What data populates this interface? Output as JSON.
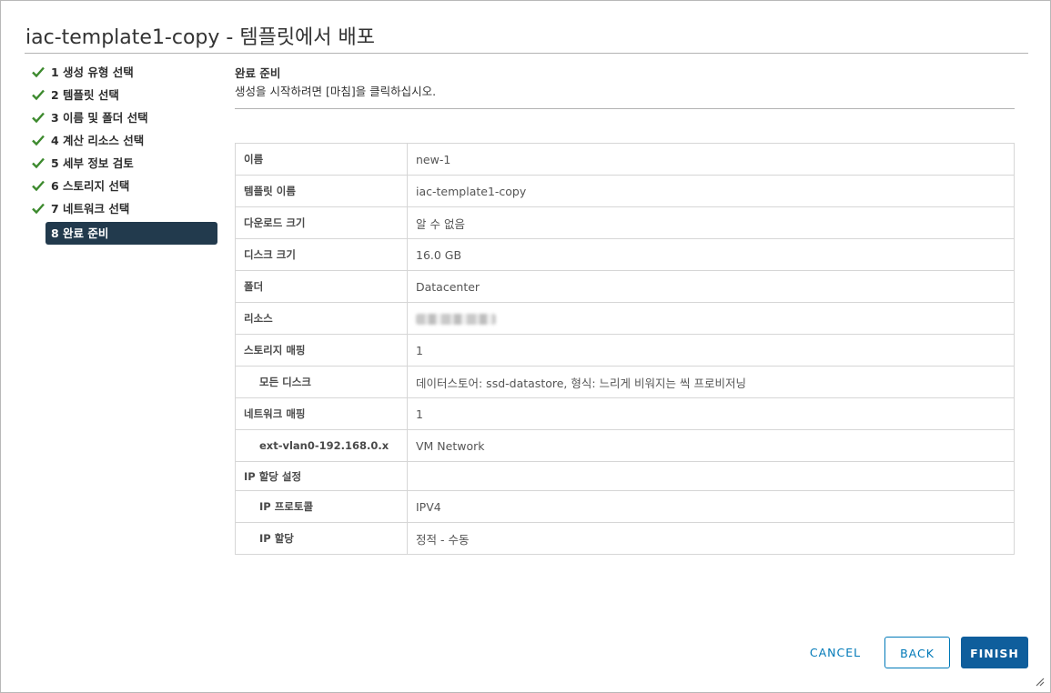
{
  "dialog": {
    "title": "iac-template1-copy - 템플릿에서 배포"
  },
  "steps": [
    {
      "label": "1 생성 유형 선택",
      "done": true
    },
    {
      "label": "2 템플릿 선택",
      "done": true
    },
    {
      "label": "3 이름 및 폴더 선택",
      "done": true
    },
    {
      "label": "4 계산 리소스 선택",
      "done": true
    },
    {
      "label": "5 세부 정보 검토",
      "done": true
    },
    {
      "label": "6 스토리지 선택",
      "done": true
    },
    {
      "label": "7 네트워크 선택",
      "done": true
    },
    {
      "label": "8 완료 준비",
      "done": false,
      "active": true
    }
  ],
  "content": {
    "title": "완료 준비",
    "subtitle": "생성을 시작하려면 [마침]을 클릭하십시오."
  },
  "summary": [
    {
      "key": "이름",
      "value": "new-1"
    },
    {
      "key": "템플릿 이름",
      "value": "iac-template1-copy"
    },
    {
      "key": "다운로드 크기",
      "value": "알 수 없음"
    },
    {
      "key": "디스크 크기",
      "value": "16.0 GB"
    },
    {
      "key": "폴더",
      "value": "Datacenter"
    },
    {
      "key": "리소스",
      "value": ""
    },
    {
      "key": "스토리지 매핑",
      "value": "1"
    },
    {
      "key": "모든 디스크",
      "value": "데이터스토어: ssd-datastore, 형식: 느리게 비워지는 씩 프로비저닝"
    },
    {
      "key": "네트워크 매핑",
      "value": "1"
    },
    {
      "key": "ext-vlan0-192.168.0.x",
      "value": "VM Network"
    },
    {
      "key": "IP 할당 설정",
      "value": ""
    },
    {
      "key": "IP 프로토콜",
      "value": "IPV4"
    },
    {
      "key": "IP 할당",
      "value": "정적 - 수동"
    }
  ],
  "buttons": {
    "cancel": "CANCEL",
    "back": "BACK",
    "finish": "FINISH"
  },
  "colors": {
    "accent": "#0079b8",
    "primary_button": "#0f5e9c",
    "active_step": "#223a4d",
    "check": "#3d8a2e"
  }
}
